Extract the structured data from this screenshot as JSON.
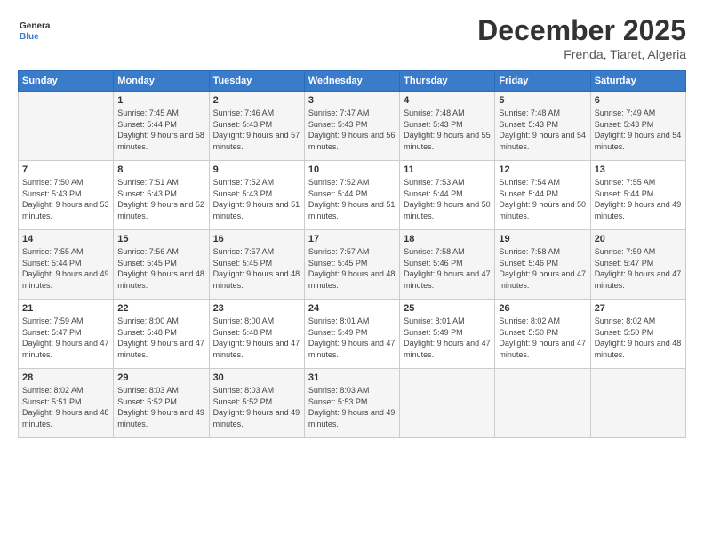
{
  "header": {
    "logo_general": "General",
    "logo_blue": "Blue",
    "title": "December 2025",
    "location": "Frenda, Tiaret, Algeria"
  },
  "weekdays": [
    "Sunday",
    "Monday",
    "Tuesday",
    "Wednesday",
    "Thursday",
    "Friday",
    "Saturday"
  ],
  "weeks": [
    [
      {
        "day": "",
        "sunrise": "",
        "sunset": "",
        "daylight": ""
      },
      {
        "day": "1",
        "sunrise": "Sunrise: 7:45 AM",
        "sunset": "Sunset: 5:44 PM",
        "daylight": "Daylight: 9 hours and 58 minutes."
      },
      {
        "day": "2",
        "sunrise": "Sunrise: 7:46 AM",
        "sunset": "Sunset: 5:43 PM",
        "daylight": "Daylight: 9 hours and 57 minutes."
      },
      {
        "day": "3",
        "sunrise": "Sunrise: 7:47 AM",
        "sunset": "Sunset: 5:43 PM",
        "daylight": "Daylight: 9 hours and 56 minutes."
      },
      {
        "day": "4",
        "sunrise": "Sunrise: 7:48 AM",
        "sunset": "Sunset: 5:43 PM",
        "daylight": "Daylight: 9 hours and 55 minutes."
      },
      {
        "day": "5",
        "sunrise": "Sunrise: 7:48 AM",
        "sunset": "Sunset: 5:43 PM",
        "daylight": "Daylight: 9 hours and 54 minutes."
      },
      {
        "day": "6",
        "sunrise": "Sunrise: 7:49 AM",
        "sunset": "Sunset: 5:43 PM",
        "daylight": "Daylight: 9 hours and 54 minutes."
      }
    ],
    [
      {
        "day": "7",
        "sunrise": "Sunrise: 7:50 AM",
        "sunset": "Sunset: 5:43 PM",
        "daylight": "Daylight: 9 hours and 53 minutes."
      },
      {
        "day": "8",
        "sunrise": "Sunrise: 7:51 AM",
        "sunset": "Sunset: 5:43 PM",
        "daylight": "Daylight: 9 hours and 52 minutes."
      },
      {
        "day": "9",
        "sunrise": "Sunrise: 7:52 AM",
        "sunset": "Sunset: 5:43 PM",
        "daylight": "Daylight: 9 hours and 51 minutes."
      },
      {
        "day": "10",
        "sunrise": "Sunrise: 7:52 AM",
        "sunset": "Sunset: 5:44 PM",
        "daylight": "Daylight: 9 hours and 51 minutes."
      },
      {
        "day": "11",
        "sunrise": "Sunrise: 7:53 AM",
        "sunset": "Sunset: 5:44 PM",
        "daylight": "Daylight: 9 hours and 50 minutes."
      },
      {
        "day": "12",
        "sunrise": "Sunrise: 7:54 AM",
        "sunset": "Sunset: 5:44 PM",
        "daylight": "Daylight: 9 hours and 50 minutes."
      },
      {
        "day": "13",
        "sunrise": "Sunrise: 7:55 AM",
        "sunset": "Sunset: 5:44 PM",
        "daylight": "Daylight: 9 hours and 49 minutes."
      }
    ],
    [
      {
        "day": "14",
        "sunrise": "Sunrise: 7:55 AM",
        "sunset": "Sunset: 5:44 PM",
        "daylight": "Daylight: 9 hours and 49 minutes."
      },
      {
        "day": "15",
        "sunrise": "Sunrise: 7:56 AM",
        "sunset": "Sunset: 5:45 PM",
        "daylight": "Daylight: 9 hours and 48 minutes."
      },
      {
        "day": "16",
        "sunrise": "Sunrise: 7:57 AM",
        "sunset": "Sunset: 5:45 PM",
        "daylight": "Daylight: 9 hours and 48 minutes."
      },
      {
        "day": "17",
        "sunrise": "Sunrise: 7:57 AM",
        "sunset": "Sunset: 5:45 PM",
        "daylight": "Daylight: 9 hours and 48 minutes."
      },
      {
        "day": "18",
        "sunrise": "Sunrise: 7:58 AM",
        "sunset": "Sunset: 5:46 PM",
        "daylight": "Daylight: 9 hours and 47 minutes."
      },
      {
        "day": "19",
        "sunrise": "Sunrise: 7:58 AM",
        "sunset": "Sunset: 5:46 PM",
        "daylight": "Daylight: 9 hours and 47 minutes."
      },
      {
        "day": "20",
        "sunrise": "Sunrise: 7:59 AM",
        "sunset": "Sunset: 5:47 PM",
        "daylight": "Daylight: 9 hours and 47 minutes."
      }
    ],
    [
      {
        "day": "21",
        "sunrise": "Sunrise: 7:59 AM",
        "sunset": "Sunset: 5:47 PM",
        "daylight": "Daylight: 9 hours and 47 minutes."
      },
      {
        "day": "22",
        "sunrise": "Sunrise: 8:00 AM",
        "sunset": "Sunset: 5:48 PM",
        "daylight": "Daylight: 9 hours and 47 minutes."
      },
      {
        "day": "23",
        "sunrise": "Sunrise: 8:00 AM",
        "sunset": "Sunset: 5:48 PM",
        "daylight": "Daylight: 9 hours and 47 minutes."
      },
      {
        "day": "24",
        "sunrise": "Sunrise: 8:01 AM",
        "sunset": "Sunset: 5:49 PM",
        "daylight": "Daylight: 9 hours and 47 minutes."
      },
      {
        "day": "25",
        "sunrise": "Sunrise: 8:01 AM",
        "sunset": "Sunset: 5:49 PM",
        "daylight": "Daylight: 9 hours and 47 minutes."
      },
      {
        "day": "26",
        "sunrise": "Sunrise: 8:02 AM",
        "sunset": "Sunset: 5:50 PM",
        "daylight": "Daylight: 9 hours and 47 minutes."
      },
      {
        "day": "27",
        "sunrise": "Sunrise: 8:02 AM",
        "sunset": "Sunset: 5:50 PM",
        "daylight": "Daylight: 9 hours and 48 minutes."
      }
    ],
    [
      {
        "day": "28",
        "sunrise": "Sunrise: 8:02 AM",
        "sunset": "Sunset: 5:51 PM",
        "daylight": "Daylight: 9 hours and 48 minutes."
      },
      {
        "day": "29",
        "sunrise": "Sunrise: 8:03 AM",
        "sunset": "Sunset: 5:52 PM",
        "daylight": "Daylight: 9 hours and 49 minutes."
      },
      {
        "day": "30",
        "sunrise": "Sunrise: 8:03 AM",
        "sunset": "Sunset: 5:52 PM",
        "daylight": "Daylight: 9 hours and 49 minutes."
      },
      {
        "day": "31",
        "sunrise": "Sunrise: 8:03 AM",
        "sunset": "Sunset: 5:53 PM",
        "daylight": "Daylight: 9 hours and 49 minutes."
      },
      {
        "day": "",
        "sunrise": "",
        "sunset": "",
        "daylight": ""
      },
      {
        "day": "",
        "sunrise": "",
        "sunset": "",
        "daylight": ""
      },
      {
        "day": "",
        "sunrise": "",
        "sunset": "",
        "daylight": ""
      }
    ]
  ]
}
